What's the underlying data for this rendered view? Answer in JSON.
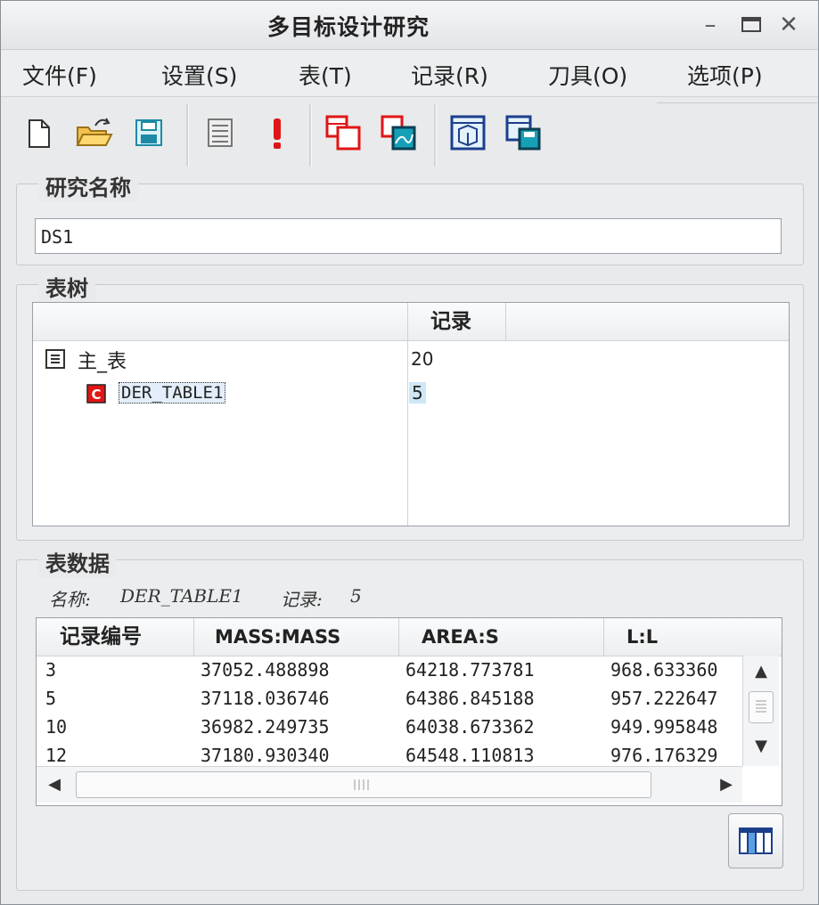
{
  "window": {
    "title": "多目标设计研究"
  },
  "menu": [
    "文件(F)",
    "设置(S)",
    "表(T)",
    "记录(R)",
    "刀具(O)",
    "选项(P)"
  ],
  "toolbar": {
    "icons": [
      "new-document-icon",
      "open-folder-icon",
      "save-icon",
      "list-icon",
      "alert-icon",
      "copy-table-icon",
      "chart-table-icon",
      "model-view-icon",
      "save-table-icon"
    ]
  },
  "study": {
    "label": "研究名称",
    "value": "DS1"
  },
  "tree": {
    "label": "表树",
    "column_records": "记录",
    "rows": [
      {
        "name": "主_表",
        "records": "20"
      },
      {
        "name": "DER_TABLE1",
        "records": "5"
      }
    ]
  },
  "table_data": {
    "label": "表数据",
    "name_label": "名称:",
    "name_value": "DER_TABLE1",
    "records_label": "记录:",
    "records_value": "5",
    "columns": [
      "记录编号",
      "MASS:MASS",
      "AREA:S",
      "L:L"
    ],
    "rows": [
      [
        "3",
        "37052.488898",
        "64218.773781",
        "968.633360"
      ],
      [
        "5",
        "37118.036746",
        "64386.845188",
        "957.222647"
      ],
      [
        "10",
        "36982.249735",
        "64038.673362",
        "949.995848"
      ],
      [
        "12",
        "37180.930340",
        "64548.110813",
        "976.176329"
      ]
    ]
  },
  "colors": {
    "accent_red": "#e01515",
    "selection_blue": "#cfe6f7"
  }
}
